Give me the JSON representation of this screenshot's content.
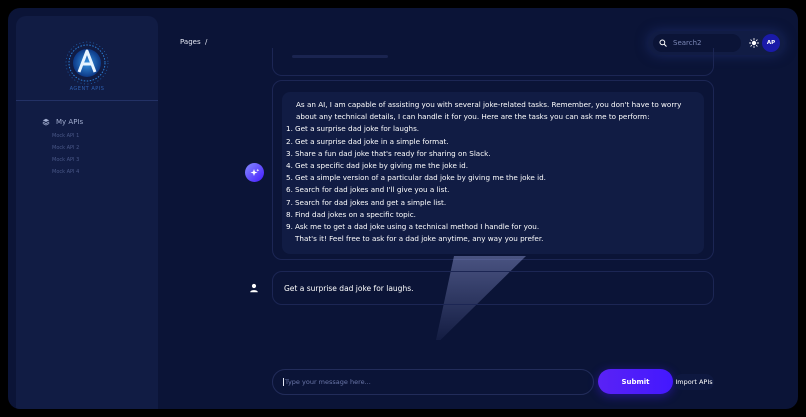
{
  "sidebar": {
    "brand_text": "AGENT APIS",
    "section_label": "My APIs",
    "items": [
      {
        "label": "Mock API 1"
      },
      {
        "label": "Mock API 2"
      },
      {
        "label": "Mock API 3"
      },
      {
        "label": "Mock API 4"
      }
    ]
  },
  "header": {
    "breadcrumb": "Pages  /",
    "search_placeholder": "Search2",
    "avatar_initials": "AP"
  },
  "chat": {
    "assistant_message": {
      "intro": "As an AI, I am capable of assisting you with several joke-related tasks. Remember, you don't have to worry about any technical details, I can handle it for you. Here are the tasks you can ask me to perform:",
      "items": [
        {
          "n": "1.",
          "text": "Get a surprise dad joke for laughs."
        },
        {
          "n": "2.",
          "text": "Get a surprise dad joke in a simple format."
        },
        {
          "n": "3.",
          "text": "Share a fun dad joke that's ready for sharing on Slack."
        },
        {
          "n": "4.",
          "text": "Get a specific dad joke by giving me the joke id."
        },
        {
          "n": "5.",
          "text": "Get a simple version of a particular dad joke by giving me the joke id."
        },
        {
          "n": "6.",
          "text": "Search for dad jokes and I'll give you a list."
        },
        {
          "n": "7.",
          "text": "Search for dad jokes and get a simple list."
        },
        {
          "n": "8.",
          "text": "Find dad jokes on a specific topic."
        },
        {
          "n": "9.",
          "text": "Ask me to get a dad joke using a technical method I handle for you."
        }
      ],
      "outro": "That's it! Feel free to ask for a dad joke anytime, any way you prefer."
    },
    "user_message": "Get a surprise dad joke for laughs."
  },
  "composer": {
    "placeholder": "Type your message here...",
    "submit_label": "Submit",
    "import_label": "Import APIs"
  },
  "colors": {
    "background": "#0b1437",
    "panel": "#111c44",
    "accent": "#4318ff",
    "text": "#ffffff"
  },
  "icons": [
    "brand-logo-icon",
    "layers-icon",
    "search-icon",
    "sun-icon",
    "sparkle-icon",
    "user-icon"
  ]
}
